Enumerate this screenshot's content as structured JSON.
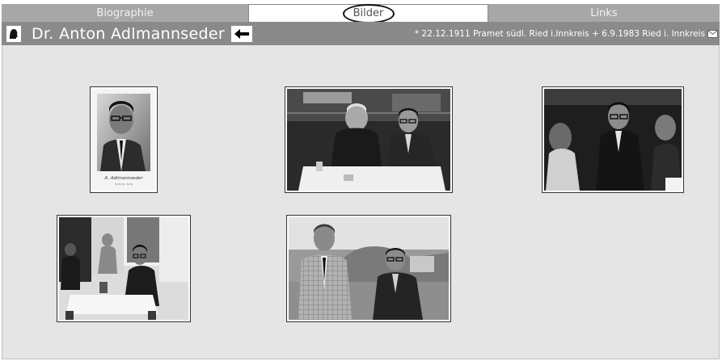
{
  "tabs": [
    {
      "label": "Biographie"
    },
    {
      "label": "Bilder"
    },
    {
      "label": "Links"
    }
  ],
  "header": {
    "title": "Dr. Anton Adlmannseder",
    "dates": "* 22.12.1911 Pramet südl. Ried i.Innkreis + 6.9.1983 Ried i. Innkreis",
    "back_icon": "arrow-left-icon",
    "person_icon": "person-head-icon",
    "mail_icon": "envelope-icon"
  },
  "gallery": {
    "photos": [
      {
        "name": "portrait-photo",
        "caption": "Dr. Anton Adlmannseder"
      },
      {
        "name": "table-conversation-photo"
      },
      {
        "name": "group-photo"
      },
      {
        "name": "room-photo"
      },
      {
        "name": "outdoor-photo"
      }
    ]
  },
  "colors": {
    "background": "#e5e5e5",
    "tab_inactive": "#a7a7a7",
    "header_bar": "#8a8a8a",
    "highlight_oval": "#111111"
  }
}
